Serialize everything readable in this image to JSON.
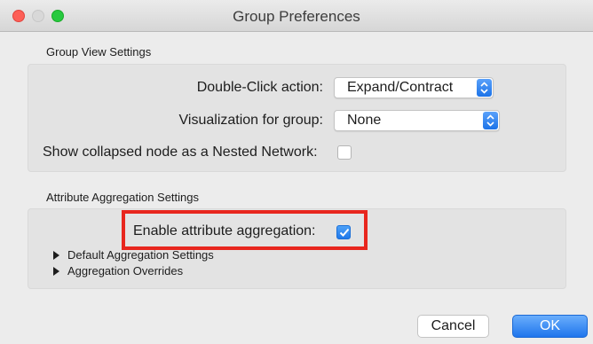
{
  "window": {
    "title": "Group Preferences"
  },
  "group_view": {
    "section_label": "Group View Settings",
    "double_click": {
      "label": "Double-Click action:",
      "value": "Expand/Contract"
    },
    "visualization": {
      "label": "Visualization for group:",
      "value": "None"
    },
    "nested_network": {
      "label": "Show collapsed node as a Nested Network:",
      "checked": false
    }
  },
  "attribute_aggregation": {
    "section_label": "Attribute Aggregation Settings",
    "enable": {
      "label": "Enable attribute aggregation:",
      "checked": true
    },
    "default_settings_label": "Default Aggregation Settings",
    "overrides_label": "Aggregation Overrides"
  },
  "buttons": {
    "cancel": "Cancel",
    "ok": "OK"
  },
  "colors": {
    "accent": "#1f78ea",
    "highlight": "#e8261e"
  }
}
